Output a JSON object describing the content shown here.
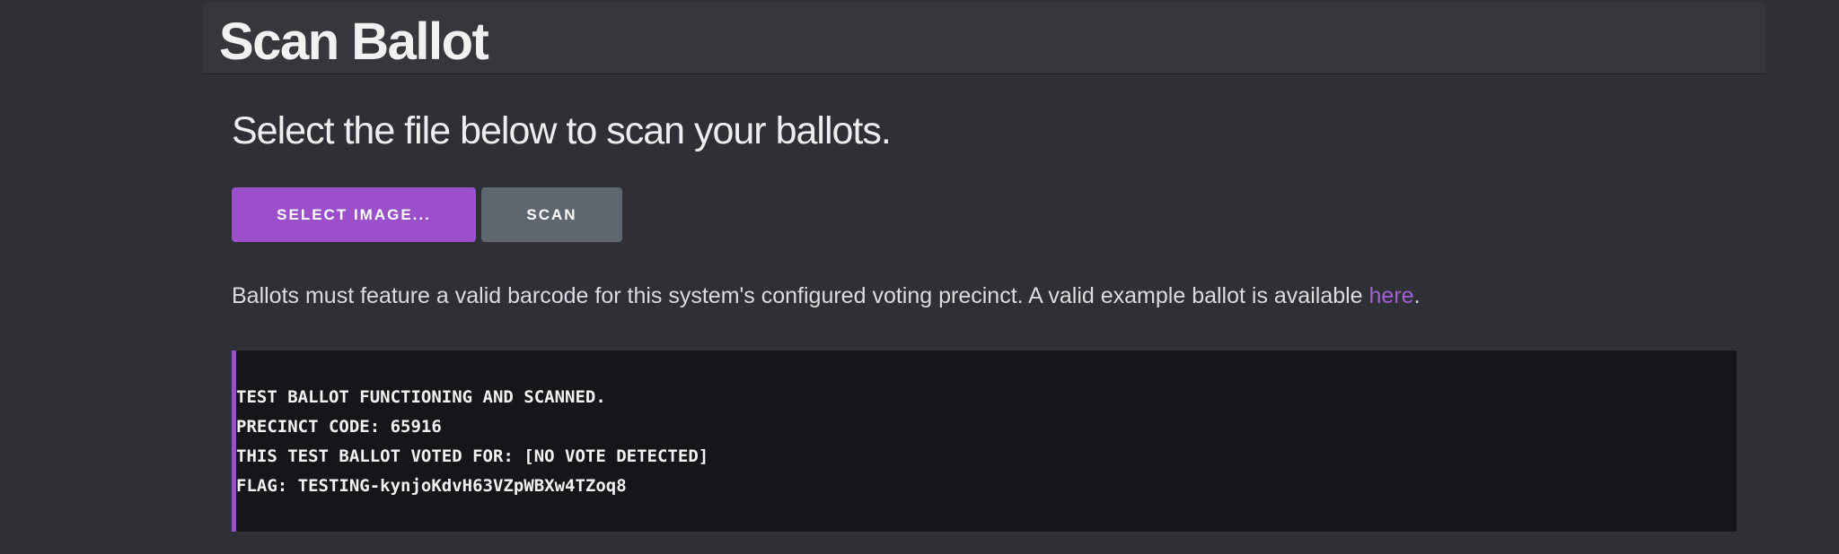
{
  "header": {
    "title": "Scan Ballot"
  },
  "main": {
    "lead": "Select the file below to scan your ballots.",
    "buttons": {
      "select_label": "SELECT IMAGE...",
      "scan_label": "SCAN"
    },
    "info": {
      "text": "Ballots must feature a valid barcode for this system's configured voting precinct. A valid example ballot is available ",
      "link_label": "here",
      "suffix": "."
    },
    "output": {
      "lines": [
        "TEST BALLOT FUNCTIONING AND SCANNED.",
        "PRECINCT CODE: 65916",
        "THIS TEST BALLOT VOTED FOR: [NO VOTE DETECTED]",
        "FLAG: TESTING-kynjoKdvH63VZpWBXw4TZoq8"
      ]
    }
  },
  "colors": {
    "background": "#2e3035",
    "header_background": "#35373c",
    "accent": "#9c4fcb",
    "secondary_button": "#5e676f",
    "link": "#a35fd6",
    "output_background": "#151619"
  }
}
